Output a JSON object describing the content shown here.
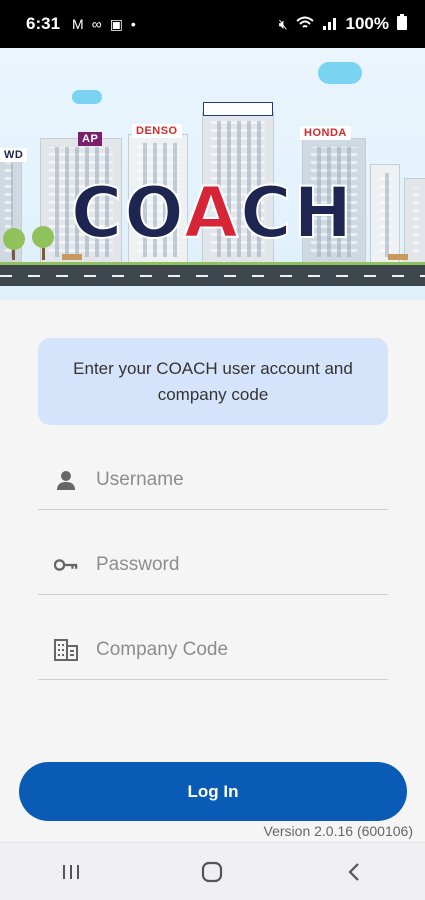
{
  "status_bar": {
    "time": "6:31",
    "left_icons": [
      "gmail-icon",
      "link-icon",
      "image-icon",
      "dot-icon"
    ],
    "right_icons": [
      "mute-icon",
      "wifi-icon",
      "signal-icon"
    ],
    "battery": "100%"
  },
  "hero": {
    "logo_part1": "CO",
    "logo_accent": "A",
    "logo_part2": "CH",
    "building_signs": [
      "DENSO",
      "HONDA",
      "AP",
      "WD"
    ]
  },
  "info": {
    "text": "Enter your COACH user account and company code"
  },
  "form": {
    "username_placeholder": "Username",
    "password_placeholder": "Password",
    "company_placeholder": "Company Code"
  },
  "login_button": "Log In",
  "version": "Version 2.0.16 (600106)",
  "nav": {
    "recent": "recent-apps-icon",
    "home": "home-icon",
    "back": "back-icon"
  },
  "colors": {
    "primary": "#0a5bb5",
    "info_bg": "#d6e4fb",
    "logo_dark": "#1d2550",
    "logo_accent": "#d62536"
  }
}
